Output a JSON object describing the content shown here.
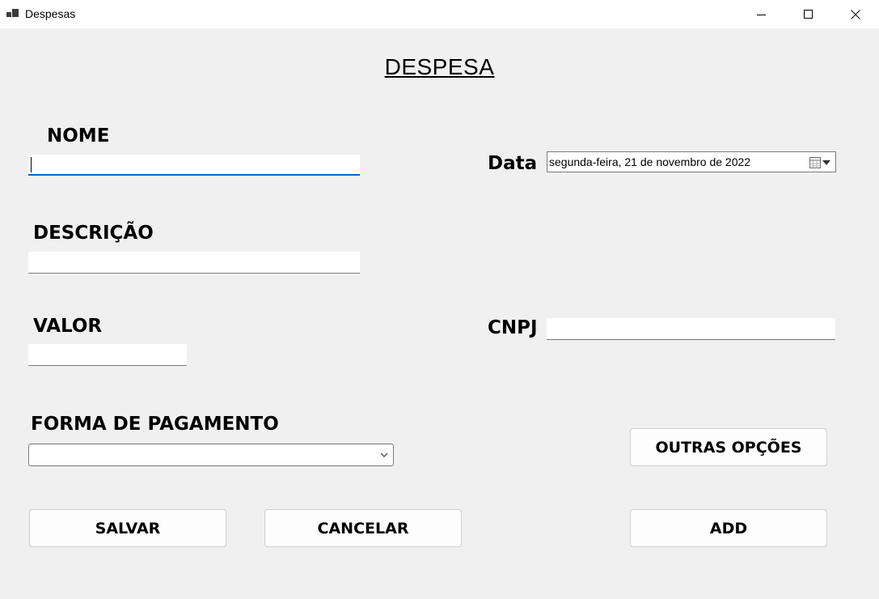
{
  "window": {
    "title": "Despesas",
    "icon": "app-icon",
    "controls": [
      "minimize-icon",
      "maximize-icon",
      "close-icon"
    ]
  },
  "form": {
    "heading": "DESPESA ",
    "nome": {
      "label": "NOME",
      "value": ""
    },
    "descricao": {
      "label": "DESCRIÇÃO",
      "value": ""
    },
    "valor": {
      "label": "VALOR",
      "value": ""
    },
    "forma_pagamento": {
      "label": "FORMA DE PAGAMENTO",
      "selected": ""
    },
    "data": {
      "label": "Data",
      "value": "segunda-feira, 21 de novembro de 2022"
    },
    "cnpj": {
      "label": "CNPJ",
      "value": ""
    }
  },
  "buttons": {
    "outras_opcoes": "OUTRAS OPÇÕES",
    "salvar": "SALVAR",
    "cancelar": "CANCELAR",
    "add": "ADD"
  },
  "colors": {
    "window_bg": "#f0f0f0",
    "titlebar_bg": "#ffffff",
    "focus_accent": "#0067c0"
  }
}
